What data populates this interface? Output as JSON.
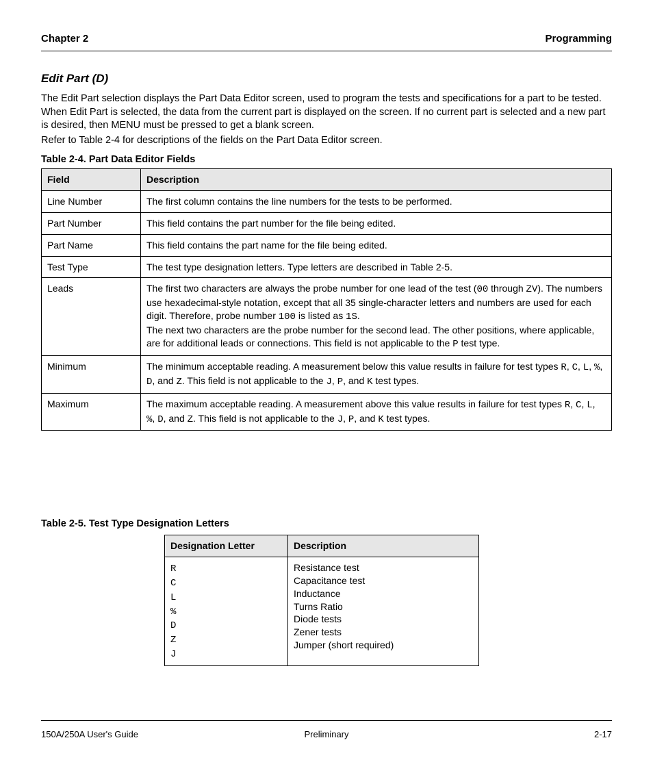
{
  "header": {
    "left": "Chapter 2",
    "right": "Programming"
  },
  "section": {
    "title": "Edit Part (D)",
    "para1": "The Edit Part selection displays the Part Data Editor screen, used to program the tests and specifications for a part to be tested. When Edit Part is selected, the data from the current part is displayed on the screen. If no current part is selected and a new part is desired, then MENU must be pressed to get a blank screen.",
    "para2": "Refer to Table 2-4 for descriptions of the fields on the Part Data Editor screen."
  },
  "table1": {
    "caption": "Table 2-4. Part Data Editor Fields",
    "headers": [
      "Field",
      "Description"
    ],
    "rows": [
      {
        "field": "Line Number",
        "desc": "The first column contains the line numbers for the tests to be performed."
      },
      {
        "field": "Part Number",
        "desc": "This field contains the part number for the file being edited."
      },
      {
        "field": "Part Name",
        "desc": "This field contains the part name for the file being edited."
      },
      {
        "field": "Test Type",
        "desc": "The test type designation letters. Type letters are described in Table 2-5."
      },
      {
        "field": "Leads",
        "desc_parts": [
          "The first two characters are always the probe number for one lead of the test (",
          "00",
          " through ",
          "ZV",
          "). The numbers use hexadecimal-style notation, except that all 35 single-character letters and numbers are used for each digit. Therefore, probe number ",
          "100",
          " is listed as ",
          "1S",
          ".",
          "\n",
          "The next two characters are the probe number for the second lead. The other positions, where applicable, are for additional leads or connections. This field is not applicable to the ",
          "P",
          " test type."
        ]
      },
      {
        "field": "Minimum",
        "desc_parts": [
          "The minimum acceptable reading. A measurement below this value results in failure for test types ",
          "R",
          ", ",
          "C",
          ", ",
          "L",
          ", ",
          "%",
          ", ",
          "D",
          ", and ",
          "Z",
          ". This field is not applicable to the ",
          "J",
          ", ",
          "P",
          ", and ",
          "K",
          " test types."
        ]
      },
      {
        "field": "Maximum",
        "desc_parts": [
          "The maximum acceptable reading. A measurement above this value results in failure for test types ",
          "R",
          ", ",
          "C",
          ", ",
          "L",
          ", ",
          "%",
          ", ",
          "D",
          ", and ",
          "Z",
          ". This field is not applicable to the ",
          "J",
          ", ",
          "P",
          ", and ",
          "K",
          " test types."
        ]
      }
    ]
  },
  "table2": {
    "caption": "Table 2-5. Test Type Designation Letters",
    "headers": [
      "Designation Letter",
      "Description"
    ],
    "row": {
      "letters_label": "R\nC\nL\n%\nD\nZ\nJ",
      "descriptions": "Resistance test\nCapacitance test\nInductance\nTurns Ratio\nDiode tests\nZener tests\nJumper (short required)"
    }
  },
  "footer": {
    "left": "150A/250A User's Guide",
    "center": "Preliminary",
    "right": "2-17"
  }
}
